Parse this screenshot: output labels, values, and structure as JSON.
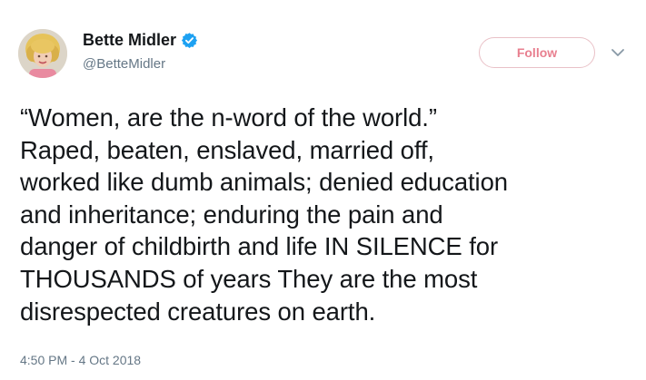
{
  "author": {
    "display_name": "Bette Midler",
    "handle": "@BetteMidler",
    "verified": true,
    "avatar_icon": "avatar-photo"
  },
  "actions": {
    "follow_label": "Follow",
    "menu_icon": "chevron-down-icon"
  },
  "tweet": {
    "text": "“Women, are the n-word of the world.”\nRaped, beaten,  enslaved, married off,\nworked like dumb animals; denied education\nand inheritance; enduring the pain and\ndanger of childbirth and life IN SILENCE for\nTHOUSANDS of years They are the most\ndisrespected creatures on earth.",
    "timestamp": "4:50 PM - 4 Oct 2018"
  },
  "colors": {
    "text": "#14171a",
    "secondary": "#657786",
    "verified_blue": "#1da1f2",
    "follow_accent": "#e87f8f"
  }
}
